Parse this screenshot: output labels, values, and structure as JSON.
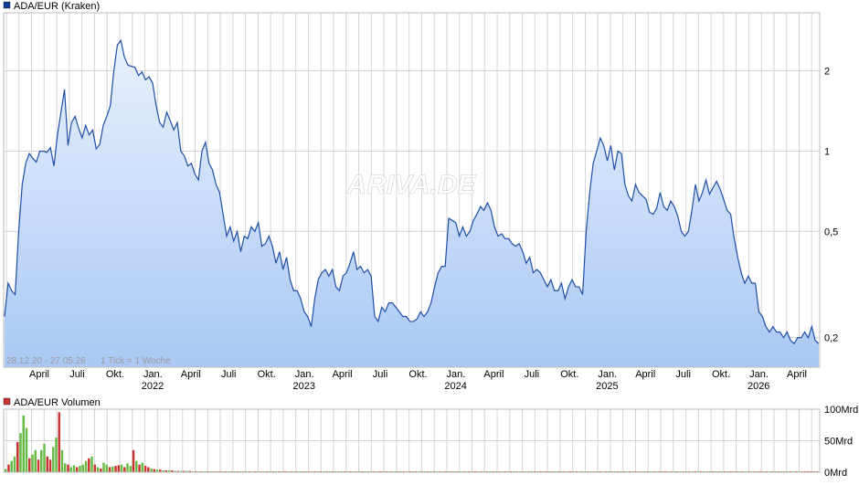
{
  "chart_data": [
    {
      "type": "area",
      "legend": "ADA/EUR (Kraken)",
      "scale": "log",
      "date_range_label": "28.12.20 - 27.05.26",
      "tick_label": "1 Tick = 1 Woche",
      "watermark": "ARIVA.DE",
      "ylim": [
        0.155,
        3.3
      ],
      "y_ticks": [
        {
          "value": 0.2,
          "label": "0,2"
        },
        {
          "value": 0.5,
          "label": "0,5"
        },
        {
          "value": 1,
          "label": "1"
        },
        {
          "value": 2,
          "label": "2"
        }
      ],
      "x_month_labels": [
        "April",
        "Juli",
        "Okt.",
        "Jan.",
        "April",
        "Juli",
        "Okt.",
        "Jan.",
        "April",
        "Juli",
        "Okt.",
        "Jan.",
        "April",
        "Juli",
        "Okt.",
        "Jan.",
        "April",
        "Juli",
        "Okt.",
        "Jan.",
        "April"
      ],
      "x_year_labels": [
        "2022",
        "2023",
        "2024",
        "2025",
        "2026"
      ],
      "series": [
        {
          "values": [
            0.24,
            0.32,
            0.3,
            0.29,
            0.5,
            0.75,
            0.9,
            0.98,
            0.94,
            0.91,
            1.0,
            1.0,
            0.99,
            1.03,
            0.88,
            1.15,
            1.4,
            1.7,
            1.05,
            1.28,
            1.35,
            1.22,
            1.12,
            1.25,
            1.15,
            1.2,
            1.02,
            1.06,
            1.25,
            1.35,
            1.48,
            2.0,
            2.5,
            2.6,
            2.25,
            2.1,
            2.08,
            2.06,
            1.92,
            1.98,
            1.85,
            1.9,
            1.8,
            1.48,
            1.28,
            1.23,
            1.4,
            1.3,
            1.2,
            1.28,
            1.0,
            0.96,
            0.88,
            0.9,
            0.82,
            0.78,
            1.0,
            1.08,
            0.9,
            0.85,
            0.75,
            0.7,
            0.58,
            0.48,
            0.52,
            0.46,
            0.5,
            0.42,
            0.48,
            0.47,
            0.52,
            0.5,
            0.54,
            0.44,
            0.45,
            0.48,
            0.44,
            0.38,
            0.42,
            0.36,
            0.4,
            0.33,
            0.3,
            0.3,
            0.28,
            0.25,
            0.24,
            0.22,
            0.28,
            0.33,
            0.35,
            0.36,
            0.34,
            0.36,
            0.31,
            0.3,
            0.34,
            0.35,
            0.38,
            0.42,
            0.36,
            0.37,
            0.35,
            0.36,
            0.34,
            0.24,
            0.23,
            0.26,
            0.25,
            0.27,
            0.27,
            0.26,
            0.25,
            0.24,
            0.24,
            0.23,
            0.23,
            0.235,
            0.25,
            0.24,
            0.25,
            0.27,
            0.31,
            0.35,
            0.37,
            0.37,
            0.56,
            0.55,
            0.54,
            0.48,
            0.52,
            0.48,
            0.5,
            0.55,
            0.58,
            0.62,
            0.6,
            0.64,
            0.6,
            0.52,
            0.48,
            0.49,
            0.47,
            0.47,
            0.45,
            0.44,
            0.45,
            0.42,
            0.38,
            0.4,
            0.35,
            0.36,
            0.35,
            0.33,
            0.31,
            0.33,
            0.3,
            0.3,
            0.32,
            0.28,
            0.31,
            0.33,
            0.31,
            0.31,
            0.29,
            0.5,
            0.7,
            0.9,
            1.0,
            1.12,
            1.05,
            0.92,
            1.05,
            0.85,
            1.0,
            0.98,
            0.75,
            0.68,
            0.65,
            0.75,
            0.7,
            0.68,
            0.66,
            0.59,
            0.58,
            0.61,
            0.7,
            0.62,
            0.6,
            0.65,
            0.62,
            0.57,
            0.5,
            0.48,
            0.5,
            0.6,
            0.75,
            0.65,
            0.7,
            0.78,
            0.69,
            0.73,
            0.77,
            0.72,
            0.66,
            0.6,
            0.58,
            0.47,
            0.4,
            0.35,
            0.32,
            0.34,
            0.32,
            0.32,
            0.25,
            0.24,
            0.22,
            0.21,
            0.22,
            0.21,
            0.21,
            0.2,
            0.21,
            0.195,
            0.19,
            0.2,
            0.2,
            0.21,
            0.2,
            0.22,
            0.195,
            0.19
          ]
        }
      ]
    },
    {
      "type": "bar",
      "legend": "ADA/EUR Volumen",
      "ylim": [
        0,
        100
      ],
      "y_ticks": [
        {
          "value": 0,
          "label": "0Mrd"
        },
        {
          "value": 50,
          "label": "50Mrd"
        },
        {
          "value": 100,
          "label": "100Mrd"
        }
      ],
      "up_color": "#66bb44",
      "down_color": "#cc3333",
      "values": [
        5,
        12,
        18,
        25,
        48,
        62,
        90,
        70,
        22,
        28,
        35,
        20,
        35,
        45,
        25,
        20,
        40,
        55,
        95,
        35,
        14,
        12,
        8,
        11,
        8,
        10,
        12,
        18,
        22,
        25,
        12,
        8,
        6,
        15,
        12,
        8,
        9,
        10,
        11,
        12,
        8,
        14,
        10,
        35,
        18,
        12,
        15,
        10,
        8,
        6,
        5,
        4,
        4,
        3,
        3,
        3,
        3,
        2,
        2,
        2,
        2,
        2,
        2,
        1,
        1,
        1,
        1,
        1,
        1,
        1,
        1,
        1,
        1,
        1,
        1,
        1,
        1,
        1,
        1,
        1,
        1,
        1,
        1,
        1,
        1,
        1,
        1,
        1,
        1,
        1,
        1,
        1,
        1,
        1,
        1,
        1,
        1,
        1,
        1,
        1,
        1,
        1,
        1,
        1,
        1,
        1,
        1,
        1,
        1,
        1,
        1,
        1,
        1,
        1,
        1,
        1,
        1,
        1,
        1,
        1,
        1,
        1,
        1,
        1,
        1,
        1,
        1,
        1,
        1,
        1,
        1,
        1,
        1,
        1,
        1,
        1,
        1,
        1,
        1,
        1,
        1,
        1,
        1,
        1,
        1,
        1,
        1,
        1,
        1,
        1,
        1,
        1,
        1,
        1,
        1,
        1,
        1,
        1,
        1,
        1,
        1,
        1,
        1,
        1,
        1,
        1,
        1,
        1,
        1,
        1,
        1,
        1,
        1,
        1,
        1,
        1,
        1,
        1,
        1,
        1,
        1,
        1,
        1,
        1,
        1,
        1,
        1,
        1,
        1,
        1,
        1,
        1,
        1,
        1,
        1,
        1,
        1,
        1,
        1,
        1,
        1,
        1,
        1,
        1,
        1,
        1,
        1,
        1,
        1,
        1,
        1,
        1,
        1,
        1,
        1,
        1,
        1,
        1,
        1,
        1,
        1,
        1,
        1,
        1,
        1,
        1,
        1,
        1,
        1,
        1,
        1,
        1,
        1,
        1,
        1,
        1,
        1,
        1,
        1,
        1,
        1,
        1,
        1,
        1,
        1,
        1,
        1,
        1,
        1,
        1,
        1,
        1,
        1,
        1,
        1,
        1,
        1,
        1,
        1,
        1,
        1,
        1,
        1,
        1,
        1,
        1,
        1,
        1,
        1,
        1,
        1,
        1,
        1,
        1
      ],
      "up": [
        1,
        0,
        1,
        1,
        0,
        1,
        1,
        1,
        0,
        1,
        1,
        0,
        1,
        1,
        0,
        0,
        1,
        1,
        0,
        1,
        1,
        0,
        1,
        1,
        0,
        1,
        1,
        1,
        0,
        1,
        0,
        1,
        0,
        1,
        1,
        0,
        1,
        0,
        0,
        1,
        0,
        1,
        1,
        0,
        1,
        0,
        1,
        0,
        0,
        1,
        0,
        1,
        0,
        1,
        0,
        1,
        0,
        1,
        0,
        1,
        0,
        1,
        0,
        1,
        0,
        1,
        0,
        1,
        0,
        1,
        0,
        1,
        0,
        1,
        0,
        1,
        0,
        1,
        0,
        1,
        0,
        1,
        0,
        1,
        0,
        1,
        0,
        1,
        0,
        1,
        0,
        1,
        0,
        1,
        0,
        1,
        0,
        1,
        0,
        1,
        0,
        1,
        0,
        1,
        0,
        1,
        0,
        1,
        0,
        1,
        0,
        1,
        0,
        1,
        0,
        1,
        0,
        1,
        0,
        1,
        0,
        1,
        0,
        1,
        0,
        1,
        0,
        1,
        0,
        1,
        0,
        1,
        0,
        1,
        0,
        1,
        0,
        1,
        0,
        1,
        0,
        1,
        0,
        1,
        0,
        1,
        0,
        1,
        0,
        1,
        0,
        1,
        0,
        1,
        0,
        1,
        0,
        1,
        0,
        1,
        0,
        1,
        0,
        1,
        0,
        1,
        0,
        1,
        0,
        1,
        0,
        1,
        0,
        1,
        0,
        1,
        0,
        1,
        0,
        1,
        0,
        1,
        0,
        1,
        0,
        1,
        0,
        1,
        0,
        1,
        0,
        1,
        0,
        1,
        0,
        1,
        0,
        1,
        0,
        1,
        0,
        1,
        0,
        1,
        0,
        1,
        0,
        1,
        0,
        1,
        0,
        1,
        0,
        1,
        0,
        1,
        0,
        1,
        0,
        1,
        0,
        1,
        0,
        1,
        0,
        1,
        0,
        1,
        0,
        1,
        0,
        1,
        0,
        1,
        0,
        1,
        0,
        1,
        0,
        1,
        0,
        1,
        0,
        1,
        0,
        1,
        0,
        1,
        0,
        1,
        0,
        1,
        0,
        1,
        0,
        1,
        0,
        1,
        0,
        1,
        0,
        1,
        0,
        1,
        0,
        1,
        0,
        1
      ]
    }
  ],
  "colors": {
    "line": "#1f4fa8",
    "area_top": "#e9f1fd",
    "area_bottom": "#aac8f4",
    "grid": "#d4d4d4",
    "legend_price": "#0b3a99",
    "legend_volume": "#cc3333"
  }
}
